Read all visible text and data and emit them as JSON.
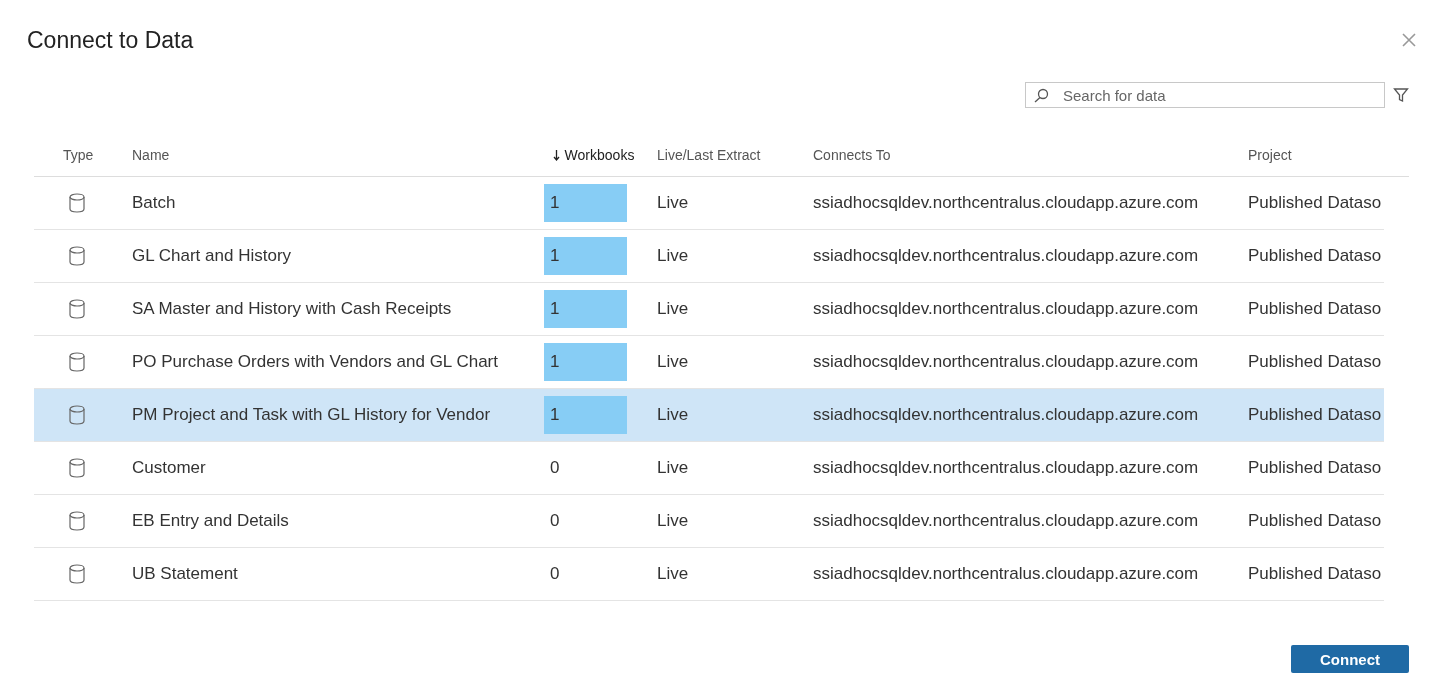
{
  "dialog": {
    "title": "Connect to Data"
  },
  "search": {
    "placeholder": "Search for data"
  },
  "table": {
    "columns": [
      {
        "label": "Type",
        "sorted": false
      },
      {
        "label": "Name",
        "sorted": false
      },
      {
        "label": "Workbooks",
        "sorted": true
      },
      {
        "label": "Live/Last Extract",
        "sorted": false
      },
      {
        "label": "Connects To",
        "sorted": false
      },
      {
        "label": "Project",
        "sorted": false
      }
    ],
    "rows": [
      {
        "name": "Batch",
        "workbooks": "1",
        "highlighted": true,
        "extract": "Live",
        "connects_to": "ssiadhocsqldev.northcentralus.cloudapp.azure.com",
        "project": "Published Dataso",
        "selected": false
      },
      {
        "name": "GL Chart and History",
        "workbooks": "1",
        "highlighted": true,
        "extract": "Live",
        "connects_to": "ssiadhocsqldev.northcentralus.cloudapp.azure.com",
        "project": "Published Dataso",
        "selected": false
      },
      {
        "name": "SA Master and History with Cash Receipts",
        "workbooks": "1",
        "highlighted": true,
        "extract": "Live",
        "connects_to": "ssiadhocsqldev.northcentralus.cloudapp.azure.com",
        "project": "Published Dataso",
        "selected": false
      },
      {
        "name": "PO Purchase Orders with Vendors and GL Chart",
        "workbooks": "1",
        "highlighted": true,
        "extract": "Live",
        "connects_to": "ssiadhocsqldev.northcentralus.cloudapp.azure.com",
        "project": "Published Dataso",
        "selected": false
      },
      {
        "name": "PM Project and Task with GL History for Vendor",
        "workbooks": "1",
        "highlighted": true,
        "extract": "Live",
        "connects_to": "ssiadhocsqldev.northcentralus.cloudapp.azure.com",
        "project": "Published Dataso",
        "selected": true
      },
      {
        "name": "Customer",
        "workbooks": "0",
        "highlighted": false,
        "extract": "Live",
        "connects_to": "ssiadhocsqldev.northcentralus.cloudapp.azure.com",
        "project": "Published Dataso",
        "selected": false
      },
      {
        "name": "EB Entry and Details",
        "workbooks": "0",
        "highlighted": false,
        "extract": "Live",
        "connects_to": "ssiadhocsqldev.northcentralus.cloudapp.azure.com",
        "project": "Published Dataso",
        "selected": false
      },
      {
        "name": "UB Statement",
        "workbooks": "0",
        "highlighted": false,
        "extract": "Live",
        "connects_to": "ssiadhocsqldev.northcentralus.cloudapp.azure.com",
        "project": "Published Dataso",
        "selected": false
      }
    ]
  },
  "buttons": [
    {
      "label": "Connect"
    }
  ]
}
